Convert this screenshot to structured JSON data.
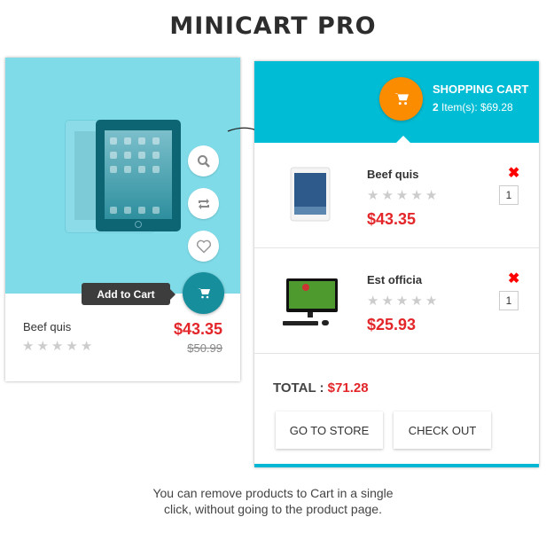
{
  "page_title": "MINICART PRO",
  "product_card": {
    "tooltip": "Add to Cart",
    "name": "Beef quis",
    "price": "$43.35",
    "old_price": "$50.99",
    "rating": 0,
    "actions": [
      "search-icon",
      "compare-icon",
      "heart-icon",
      "cart-icon"
    ]
  },
  "cart": {
    "title": "SHOPPING CART",
    "item_count": "2",
    "summary": " Item(s): $69.28",
    "items": [
      {
        "name": "Beef quis",
        "price": "$43.35",
        "qty": "1",
        "rating": 0,
        "remove": "✖",
        "image": "tablet"
      },
      {
        "name": "Est officia",
        "price": "$25.93",
        "qty": "1",
        "rating": 0,
        "remove": "✖",
        "image": "desktop"
      }
    ],
    "total_label": "TOTAL : ",
    "total_value": "$71.28",
    "buttons": {
      "store": "GO TO STORE",
      "checkout": "CHECK OUT"
    }
  },
  "caption": {
    "line1": "You can remove products to Cart in a single",
    "line2": "click, without going to the product page."
  },
  "colors": {
    "accent": "#00bcd4",
    "cart_circle": "#fb8c00",
    "price": "#e3262a"
  }
}
